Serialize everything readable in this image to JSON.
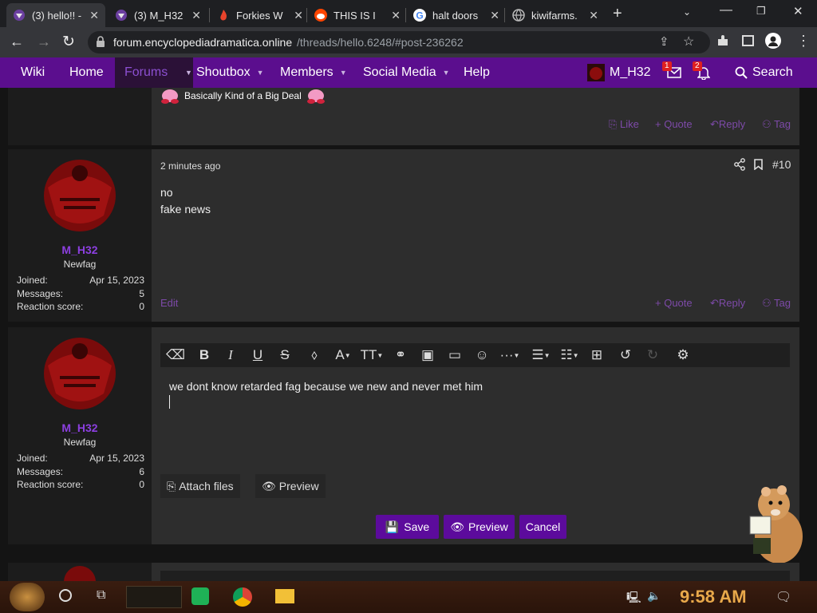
{
  "tabs": [
    {
      "title": "(3) hello!! -",
      "icon": "forum-favicon-icon",
      "active": true
    },
    {
      "title": "(3) M_H32",
      "icon": "forum-favicon-icon",
      "active": false
    },
    {
      "title": "Forkies W",
      "icon": "flame-favicon-icon",
      "active": false
    },
    {
      "title": "THIS IS I",
      "icon": "reddit-favicon-icon",
      "active": false
    },
    {
      "title": "halt doors",
      "icon": "google-favicon-icon",
      "active": false
    },
    {
      "title": "kiwifarms.",
      "icon": "globe-favicon-icon",
      "active": false
    }
  ],
  "address": {
    "domain": "forum.encyclopediadramatica.online",
    "path": "/threads/hello.6248/#post-236262"
  },
  "nav": {
    "items": [
      "Wiki",
      "Home",
      "Forums",
      "Shoutbox",
      "Members",
      "Social Media",
      "Help"
    ],
    "active": "Forums",
    "username": "M_H32",
    "inbox_count": "1",
    "alerts_count": "2",
    "search_label": "Search"
  },
  "prev_post": {
    "signature": "Basically Kind of a Big Deal",
    "actions": [
      "Like",
      "+ Quote",
      "Reply",
      "Tag"
    ]
  },
  "post10": {
    "time": "2 minutes ago",
    "number": "#10",
    "lines": [
      "no",
      "fake news"
    ],
    "edit_label": "Edit",
    "actions": [
      "+ Quote",
      "Reply",
      "Tag"
    ],
    "user": {
      "name": "M_H32",
      "title": "Newfag",
      "joined_label": "Joined:",
      "joined": "Apr 15, 2023",
      "messages_label": "Messages:",
      "messages": "5",
      "reaction_label": "Reaction score:",
      "reaction": "0"
    }
  },
  "editor": {
    "text": "we dont know retarded fag because we new and never met him",
    "attach_label": "Attach files",
    "preview_label": "Preview",
    "save_label": "Save",
    "preview2_label": "Preview",
    "cancel_label": "Cancel",
    "user": {
      "name": "M_H32",
      "title": "Newfag",
      "joined_label": "Joined:",
      "joined": "Apr 15, 2023",
      "messages_label": "Messages:",
      "messages": "6",
      "reaction_label": "Reaction score:",
      "reaction": "0"
    }
  },
  "taskbar": {
    "time": "9:58 AM"
  },
  "colors": {
    "accent": "#5c0b9c",
    "nav": "#5b0e8e",
    "link": "#8c3fe0",
    "avatar": "#8b0d0d"
  }
}
